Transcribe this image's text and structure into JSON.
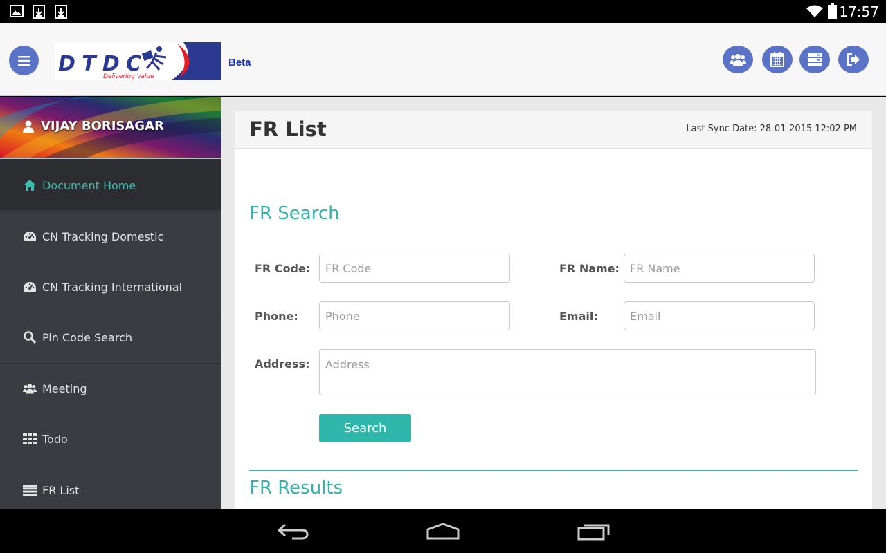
{
  "status_bar": {
    "time": "17:57"
  },
  "header": {
    "logo_text": "DTDC",
    "logo_tagline": "Delivering Value",
    "beta_label": "Beta",
    "actions": [
      "users-icon",
      "calendar-icon",
      "server-icon",
      "logout-icon"
    ]
  },
  "sidebar": {
    "user_name": "VIJAY BORISAGAR",
    "items": [
      {
        "label": "Document Home",
        "icon": "home-icon",
        "active": true
      },
      {
        "label": "CN Tracking Domestic",
        "icon": "dashboard-icon",
        "active": false
      },
      {
        "label": "CN Tracking International",
        "icon": "dashboard-icon",
        "active": false
      },
      {
        "label": "Pin Code Search",
        "icon": "search-icon",
        "active": false
      },
      {
        "label": "Meeting",
        "icon": "users-icon",
        "active": false
      },
      {
        "label": "Todo",
        "icon": "grid-icon",
        "active": false
      },
      {
        "label": "FR List",
        "icon": "list-icon",
        "active": false
      }
    ]
  },
  "main": {
    "page_title": "FR List",
    "sync_text": "Last Sync Date: 28-01-2015 12:02 PM",
    "search_section_title": "FR Search",
    "fields": {
      "fr_code": {
        "label": "FR Code:",
        "placeholder": "FR Code"
      },
      "fr_name": {
        "label": "FR Name:",
        "placeholder": "FR Name"
      },
      "phone": {
        "label": "Phone:",
        "placeholder": "Phone"
      },
      "email": {
        "label": "Email:",
        "placeholder": "Email"
      },
      "address": {
        "label": "Address:",
        "placeholder": "Address"
      }
    },
    "search_button": "Search",
    "results_section_title": "FR Results"
  },
  "colors": {
    "accent": "#30b7ac",
    "header_button": "#5b73c7",
    "sidebar_bg": "#3a3c42",
    "brand_blue": "#2b3990",
    "brand_red": "#e31e24"
  }
}
